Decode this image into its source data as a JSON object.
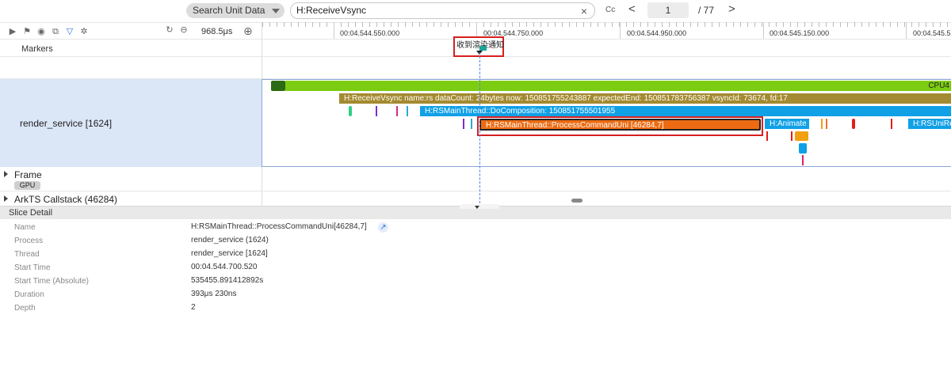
{
  "search": {
    "type_label": "Search Unit Data",
    "query": "H:ReceiveVsync",
    "clear_glyph": "×",
    "case_label": "Cc",
    "prev_glyph": "<",
    "next_glyph": ">",
    "current_page": "1",
    "total_pages": "/ 77"
  },
  "toolbar": {
    "icons": [
      "play-icon",
      "flag-icon",
      "target-icon",
      "screenshot-icon",
      "filter-icon",
      "settings-icon"
    ],
    "zoom_value": "968.5μs",
    "zoom_plus": "⊕",
    "history_icon": "↻",
    "minus_icon": "⊖"
  },
  "timeline": {
    "ticks": [
      "00:04.544.550.000",
      "00:04.544.750.000",
      "00:04.544.950.000",
      "00:04.545.150.000",
      "00:04.545.5"
    ]
  },
  "markers": {
    "label": "Markers",
    "marker_text": "收到渲染通知"
  },
  "process": {
    "label": "render_service [1624]"
  },
  "slices": {
    "cpu_label": "CPU4",
    "vsync": "H:ReceiveVsync name:rs dataCount: 24bytes now: 150851755243887 expectedEnd: 150851783756387 vsyncId: 73674, fd:17",
    "do_composition": "H:RSMainThread::DoComposition: 150851755501955",
    "process_command": "H:RSMainThread::ProcessCommandUni [46284,7]",
    "animate": "H:Animate",
    "rsuni": "H:RSUniRe"
  },
  "colors": {
    "cpu": "#7ccc12",
    "vsync": "#a48a30",
    "composition": "#10a0e6",
    "process_command": "#ec6b12",
    "highlight": "#d61f1f"
  },
  "rows": {
    "frame": "Frame",
    "gpu": "GPU",
    "arkts": "ArkTS Callstack (46284)"
  },
  "detail": {
    "title": "Slice Detail",
    "fields": [
      {
        "key": "Name",
        "value": "H:RSMainThread::ProcessCommandUni[46284,7]"
      },
      {
        "key": "Process",
        "value": "render_service (1624)"
      },
      {
        "key": "Thread",
        "value": "render_service [1624]"
      },
      {
        "key": "Start Time",
        "value": "00:04.544.700.520"
      },
      {
        "key": "Start Time (Absolute)",
        "value": "535455.891412892s"
      },
      {
        "key": "Duration",
        "value": "393μs 230ns"
      },
      {
        "key": "Depth",
        "value": "2"
      }
    ]
  }
}
